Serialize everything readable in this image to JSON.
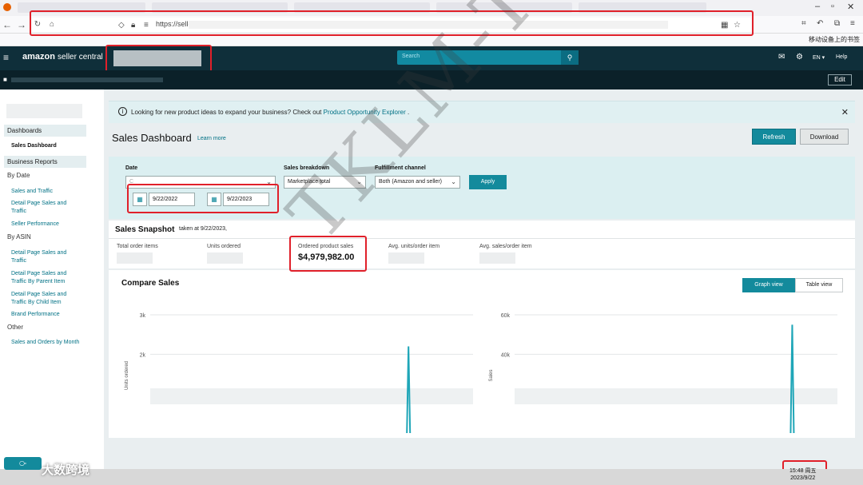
{
  "browser": {
    "url_prefix": "https://sellc",
    "mobile_bookmark": "移动设备上的书签"
  },
  "header": {
    "logo_brand": "amazon",
    "logo_product": "seller central",
    "search_placeholder": "Search",
    "language": "EN ▾",
    "help": "Help",
    "edit": "Edit"
  },
  "sidebar": {
    "dashboards_section": "Dashboards",
    "sales_dashboard": "Sales Dashboard",
    "business_reports_section": "Business Reports",
    "by_date": "By Date",
    "by_date_items": [
      "Sales and Traffic",
      "Detail Page Sales and Traffic",
      "Seller Performance"
    ],
    "by_asin": "By ASIN",
    "by_asin_items": [
      "Detail Page Sales and Traffic",
      "Detail Page Sales and Traffic By Parent Item",
      "Detail Page Sales and Traffic By Child Item",
      "Brand Performance"
    ],
    "other": "Other",
    "other_items": [
      "Sales and Orders by Month"
    ]
  },
  "banner": {
    "text": "Looking for new product ideas to expand your business? Check out",
    "link": "Product Opportunity Explorer"
  },
  "page": {
    "title": "Sales Dashboard",
    "learn_more": "Learn more",
    "refresh": "Refresh",
    "download": "Download"
  },
  "filters": {
    "date_label": "Date",
    "date_select": "C",
    "start_date": "9/22/2022",
    "end_date": "9/22/2023",
    "sales_breakdown_label": "Sales breakdown",
    "sales_breakdown_value": "Marketplace total",
    "fulfillment_label": "Fulfillment channel",
    "fulfillment_value": "Both (Amazon and seller)",
    "apply": "Apply"
  },
  "snapshot": {
    "title": "Sales Snapshot",
    "taken_at": "taken at 9/22/2023,",
    "metrics": [
      {
        "label": "Total order items",
        "value": ""
      },
      {
        "label": "Units ordered",
        "value": ""
      },
      {
        "label": "Ordered product sales",
        "value": "$4,979,982.00"
      },
      {
        "label": "Avg. units/order item",
        "value": ""
      },
      {
        "label": "Avg. sales/order item",
        "value": ""
      }
    ]
  },
  "compare": {
    "title": "Compare Sales",
    "graph_view": "Graph view",
    "table_view": "Table view",
    "left_chart": {
      "ylabel": "Units ordered",
      "ticks": [
        "3k",
        "2k"
      ]
    },
    "right_chart": {
      "ylabel": "Sales",
      "ticks": [
        "60k",
        "40k"
      ]
    }
  },
  "chart_data": [
    {
      "type": "line",
      "ylabel": "Units ordered",
      "yticks": [
        "3k",
        "2k"
      ],
      "ylim": [
        0,
        3000
      ],
      "x": [
        0,
        0.5,
        1
      ],
      "values": [
        0,
        2200,
        0
      ],
      "color": "#1fa6b8"
    },
    {
      "type": "line",
      "ylabel": "Sales",
      "yticks": [
        "60k",
        "40k"
      ],
      "ylim": [
        0,
        60000
      ],
      "x": [
        0,
        0.5,
        1
      ],
      "values": [
        0,
        55000,
        0
      ],
      "color": "#1fa6b8"
    }
  ],
  "overlay": {
    "watermark": "TKLM-TKLM",
    "brand_logo": "大数跨境",
    "clock_time": "15:48 周五",
    "clock_date": "2023/9/22"
  },
  "colors": {
    "header_bg": "#0f2f3a",
    "accent": "#138a9c",
    "link": "#007185",
    "highlight_box": "#e0202a"
  }
}
